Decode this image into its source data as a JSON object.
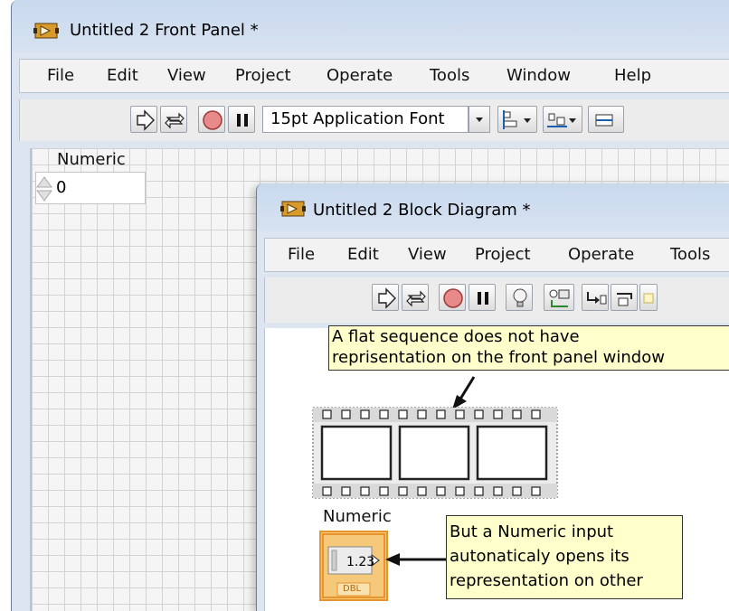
{
  "front_panel": {
    "title": "Untitled 2 Front Panel *",
    "menu": [
      "File",
      "Edit",
      "View",
      "Project",
      "Operate",
      "Tools",
      "Window",
      "Help"
    ],
    "font_select": "15pt Application Font",
    "control": {
      "label": "Numeric",
      "value": "0"
    }
  },
  "block_diagram": {
    "title": "Untitled 2 Block Diagram *",
    "menu": [
      "File",
      "Edit",
      "View",
      "Project",
      "Operate",
      "Tools"
    ],
    "note_top": {
      "line1": "A flat sequence does not have",
      "line2": "reprisentation on the front panel window"
    },
    "note_bottom": {
      "line1": "But a Numeric input",
      "line2": "autonaticaly opens its",
      "line3": "representation on other"
    },
    "terminal": {
      "label": "Numeric",
      "value": "1.23",
      "type": "DBL"
    }
  },
  "colors": {
    "title_bar": "#c9d9ee",
    "note_bg": "#ffffcc",
    "terminal_border": "#e8942e",
    "terminal_fill": "#f6c87a"
  }
}
